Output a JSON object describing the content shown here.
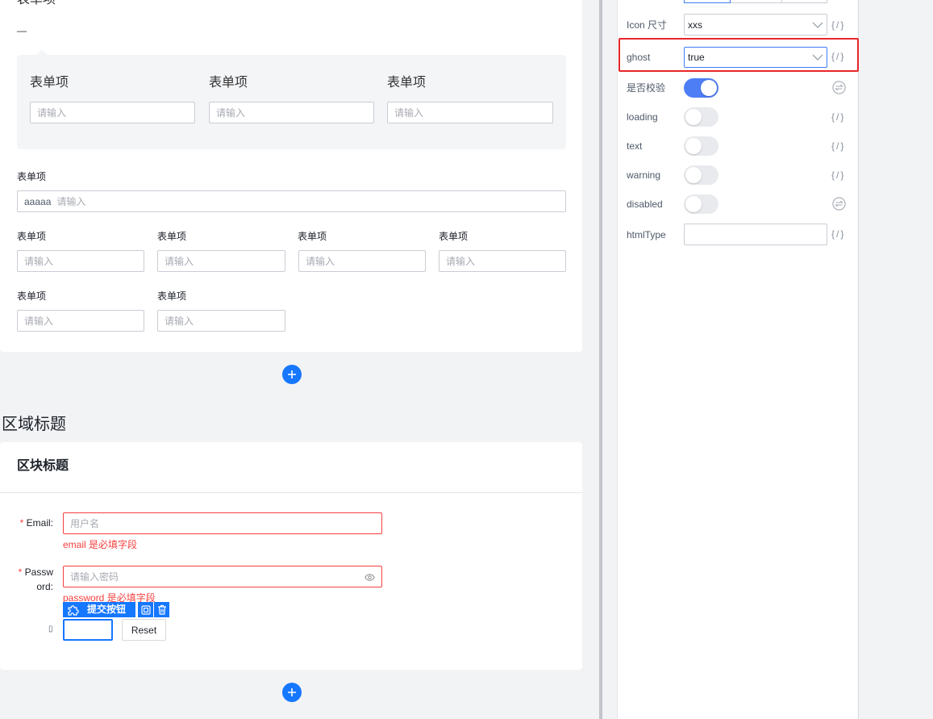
{
  "colors": {
    "accent": "#1677ff",
    "switch_on": "#4e7ef5",
    "error": "#f53f3f",
    "highlight": "#e8262a",
    "focus_border": "#3d7df6"
  },
  "canvas": {
    "top_card": {
      "cut_label": "表单项",
      "collapse_mark": "—",
      "group": [
        {
          "label": "表单项",
          "placeholder": "请输入"
        },
        {
          "label": "表单项",
          "placeholder": "请输入"
        },
        {
          "label": "表单项",
          "placeholder": "请输入"
        }
      ],
      "full_item": {
        "label": "表单项",
        "prefix": "aaaaa",
        "placeholder": "请输入"
      },
      "row_four": [
        {
          "label": "表单项",
          "placeholder": "请输入"
        },
        {
          "label": "表单项",
          "placeholder": "请输入"
        },
        {
          "label": "表单项",
          "placeholder": "请输入"
        },
        {
          "label": "表单项",
          "placeholder": "请输入"
        }
      ],
      "row_two": [
        {
          "label": "表单项",
          "placeholder": "请输入"
        },
        {
          "label": "表单项",
          "placeholder": "请输入"
        }
      ]
    },
    "add_icon": "plus-circle-icon",
    "region_title": "区域标题",
    "block_card": {
      "title": "区块标题",
      "required_mark": "*",
      "email": {
        "label": "Email:",
        "placeholder": "用户名",
        "error": "email 是必填字段"
      },
      "password": {
        "label": "Password:",
        "placeholder": "请输入密码",
        "error": "password 是必填字段",
        "suffix_icon": "eye-icon"
      },
      "selection_toolbar": {
        "handle_icon": "puzzle-icon",
        "component_label": "提交按钮",
        "copy_icon": "copy-icon",
        "delete_icon": "delete-icon"
      },
      "actions": {
        "label_glyph": "▯",
        "reset_label": "Reset"
      }
    }
  },
  "props_panel": {
    "rows": [
      {
        "label": "Icon 尺寸",
        "value": "xxs",
        "expr": "{/}"
      },
      {
        "label": "ghost",
        "value": "true",
        "expr": "{/}",
        "highlighted": true
      },
      {
        "label": "是否校验",
        "on": true,
        "icon": "transform-icon"
      },
      {
        "label": "loading",
        "on": false,
        "expr": "{/}"
      },
      {
        "label": "text",
        "on": false,
        "expr": "{/}"
      },
      {
        "label": "warning",
        "on": false,
        "expr": "{/}"
      },
      {
        "label": "disabled",
        "on": false,
        "icon": "transform-icon"
      },
      {
        "label": "htmlType",
        "expr": "{/}"
      }
    ]
  }
}
